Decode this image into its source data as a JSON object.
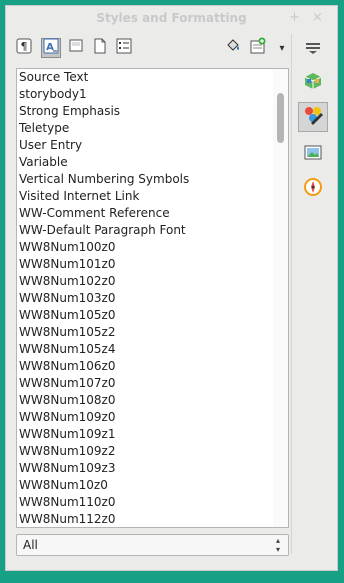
{
  "window": {
    "title": "Styles and Formatting",
    "pin_glyph": "+",
    "close_glyph": "×"
  },
  "toolbar": {
    "tools": [
      {
        "name": "paragraph-styles-icon",
        "active": false
      },
      {
        "name": "character-styles-icon",
        "active": true
      },
      {
        "name": "frame-styles-icon",
        "active": false
      },
      {
        "name": "page-styles-icon",
        "active": false
      },
      {
        "name": "list-styles-icon",
        "active": false
      }
    ],
    "fill_format_icon": "paint-bucket-icon",
    "new_style_icon": "new-style-icon",
    "menu_arrow": "▾"
  },
  "styles_list": {
    "items": [
      "Source Text",
      "storybody1",
      "Strong Emphasis",
      "Teletype",
      "User Entry",
      "Variable",
      "Vertical Numbering Symbols",
      "Visited Internet Link",
      "WW-Comment Reference",
      "WW-Default Paragraph Font",
      "WW8Num100z0",
      "WW8Num101z0",
      "WW8Num102z0",
      "WW8Num103z0",
      "WW8Num105z0",
      "WW8Num105z2",
      "WW8Num105z4",
      "WW8Num106z0",
      "WW8Num107z0",
      "WW8Num108z0",
      "WW8Num109z0",
      "WW8Num109z1",
      "WW8Num109z2",
      "WW8Num109z3",
      "WW8Num10z0",
      "WW8Num110z0",
      "WW8Num112z0"
    ]
  },
  "filter": {
    "value": "All"
  },
  "sidebar": {
    "buttons": [
      {
        "name": "sidebar-menu-icon"
      },
      {
        "name": "properties-icon"
      },
      {
        "name": "styles-icon",
        "active": true
      },
      {
        "name": "gallery-icon"
      },
      {
        "name": "navigator-icon"
      }
    ]
  },
  "colors": {
    "desktop": "#16a085",
    "panel": "#ebebea",
    "list_bg": "#ffffff"
  }
}
